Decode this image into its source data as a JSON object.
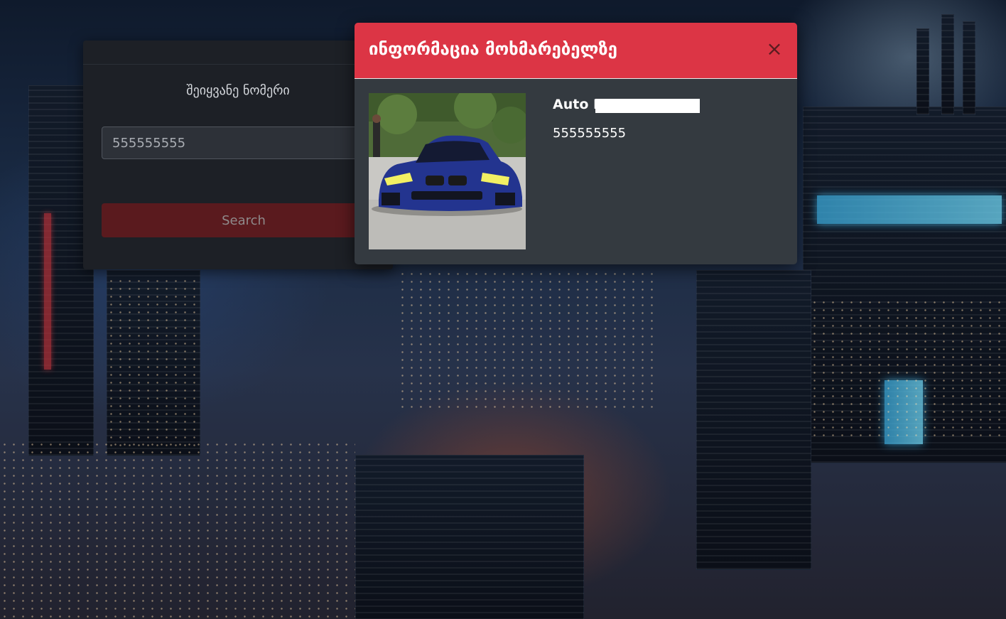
{
  "search": {
    "label": "შეიყვანე ნომერი",
    "value": "555555555",
    "button_label": "Search"
  },
  "modal": {
    "title": "ინფორმაცია მოხმარებელზე",
    "close_symbol": "×",
    "user_name": "Auto E",
    "phone": "555555555"
  },
  "colors": {
    "modal_header": "#dc3545",
    "modal_body": "#343a40",
    "search_card": "#1d2026",
    "search_button": "#5a1a1e"
  }
}
